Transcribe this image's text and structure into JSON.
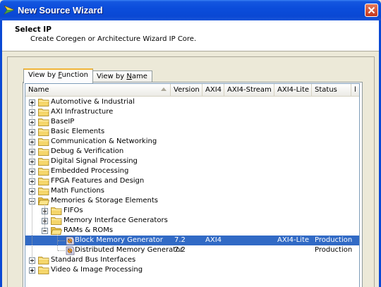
{
  "window": {
    "title": "New Source Wizard",
    "close_icon": "close-icon"
  },
  "header": {
    "title": "Select IP",
    "subtitle": "Create Coregen or Architecture Wizard IP Core."
  },
  "tabs": [
    {
      "label_pre": "View by ",
      "label_ul": "F",
      "label_post": "unction",
      "active": true
    },
    {
      "label_pre": "View by ",
      "label_ul": "N",
      "label_post": "ame",
      "active": false
    }
  ],
  "columns": [
    "Name",
    "Version",
    "AXI4",
    "AXI4-Stream",
    "AXI4-Lite",
    "Status",
    "l"
  ],
  "tree": [
    {
      "label": "Automotive & Industrial",
      "level": 0,
      "expander": "plus",
      "icon": "folder"
    },
    {
      "label": "AXI Infrastructure",
      "level": 0,
      "expander": "plus",
      "icon": "folder"
    },
    {
      "label": "BaseIP",
      "level": 0,
      "expander": "plus",
      "icon": "folder"
    },
    {
      "label": "Basic Elements",
      "level": 0,
      "expander": "plus",
      "icon": "folder"
    },
    {
      "label": "Communication & Networking",
      "level": 0,
      "expander": "plus",
      "icon": "folder"
    },
    {
      "label": "Debug & Verification",
      "level": 0,
      "expander": "plus",
      "icon": "folder"
    },
    {
      "label": "Digital Signal Processing",
      "level": 0,
      "expander": "plus",
      "icon": "folder"
    },
    {
      "label": "Embedded Processing",
      "level": 0,
      "expander": "plus",
      "icon": "folder"
    },
    {
      "label": "FPGA Features and Design",
      "level": 0,
      "expander": "plus",
      "icon": "folder"
    },
    {
      "label": "Math Functions",
      "level": 0,
      "expander": "plus",
      "icon": "folder"
    },
    {
      "label": "Memories & Storage Elements",
      "level": 0,
      "expander": "minus",
      "icon": "folder-open"
    },
    {
      "label": "FIFOs",
      "level": 1,
      "expander": "plus",
      "icon": "folder"
    },
    {
      "label": "Memory Interface Generators",
      "level": 1,
      "expander": "plus",
      "icon": "folder"
    },
    {
      "label": "RAMs & ROMs",
      "level": 1,
      "expander": "minus",
      "icon": "folder-open"
    },
    {
      "label": "Block Memory Generator",
      "level": 2,
      "icon": "ip-core",
      "version": "7.2",
      "axi4": "AXI4",
      "axi4_stream": "",
      "axi4_lite": "AXI4-Lite",
      "status": "Production",
      "selected": true
    },
    {
      "label": "Distributed Memory Generator",
      "level": 2,
      "icon": "ip-core",
      "version": "7.2",
      "axi4": "",
      "axi4_stream": "",
      "axi4_lite": "",
      "status": "Production",
      "selected": false
    },
    {
      "label": "Standard Bus Interfaces",
      "level": 0,
      "expander": "plus",
      "icon": "folder"
    },
    {
      "label": "Video & Image Processing",
      "level": 0,
      "expander": "plus",
      "icon": "folder"
    }
  ],
  "colors": {
    "titlebar": "#0a48d4",
    "selection": "#316ac5",
    "tab_highlight": "#f0b438",
    "folder": "#f5d66b"
  }
}
